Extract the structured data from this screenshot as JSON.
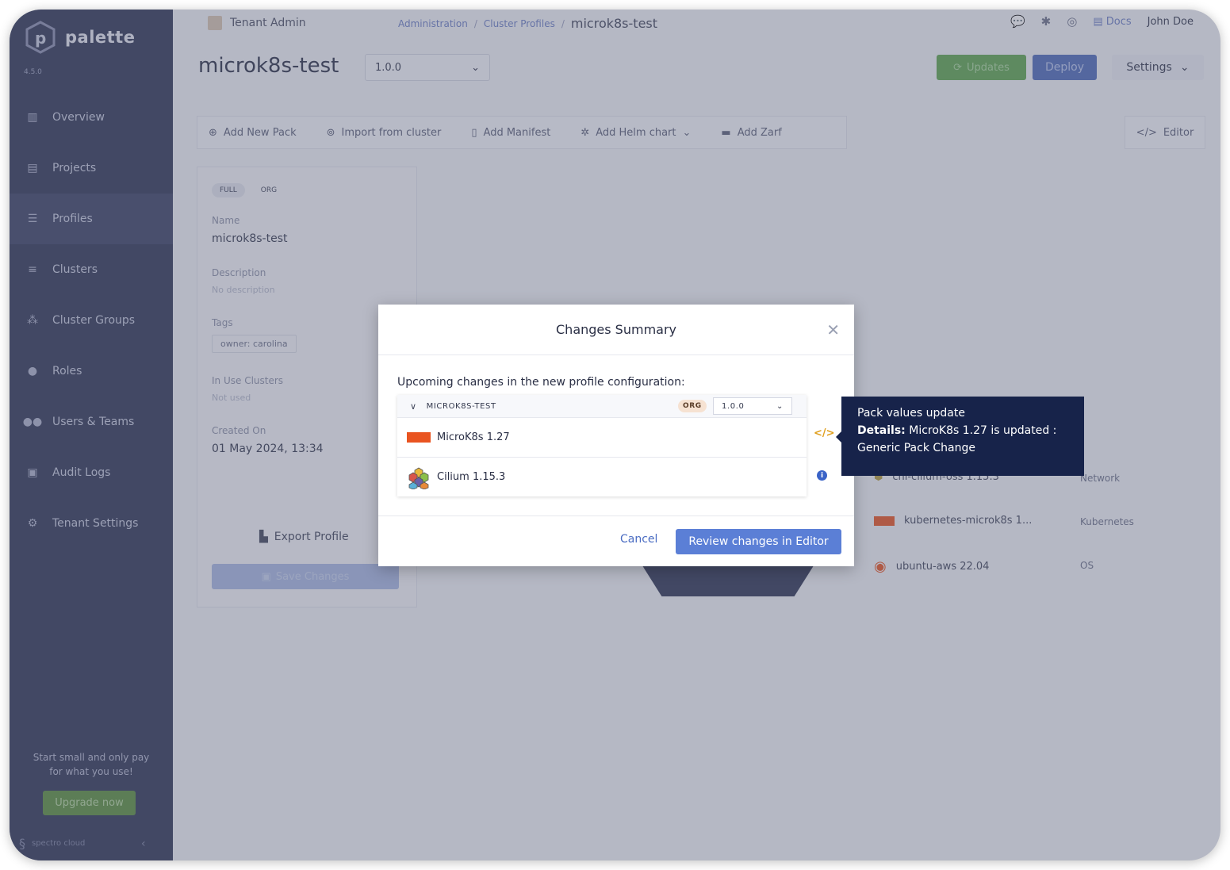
{
  "app": {
    "brand": "palette",
    "version": "4.5.0"
  },
  "sidebar": {
    "items": [
      {
        "label": "Overview",
        "icon": "chart-icon"
      },
      {
        "label": "Projects",
        "icon": "projects-icon"
      },
      {
        "label": "Profiles",
        "icon": "layers-icon",
        "active": true
      },
      {
        "label": "Clusters",
        "icon": "clusters-icon"
      },
      {
        "label": "Cluster Groups",
        "icon": "cluster-groups-icon"
      },
      {
        "label": "Roles",
        "icon": "roles-icon"
      },
      {
        "label": "Users & Teams",
        "icon": "users-icon"
      },
      {
        "label": "Audit Logs",
        "icon": "audit-icon"
      },
      {
        "label": "Tenant Settings",
        "icon": "gear-icon"
      }
    ],
    "promo_line1": "Start small and only pay",
    "promo_line2": "for what you use!",
    "upgrade_label": "Upgrade now",
    "footer_brand": "spectro cloud"
  },
  "header": {
    "tenant": "Tenant Admin",
    "breadcrumb": [
      "Administration",
      "Cluster Profiles",
      "microk8s-test"
    ],
    "docs": "Docs",
    "user": "John Doe"
  },
  "profile": {
    "title": "microk8s-test",
    "version": "1.0.0",
    "updates_label": "Updates",
    "deploy_label": "Deploy",
    "settings_label": "Settings"
  },
  "toolbar": {
    "add_new_pack": "Add New Pack",
    "import_from_cluster": "Import from cluster",
    "add_manifest": "Add Manifest",
    "add_helm_chart": "Add Helm chart",
    "add_zarf": "Add Zarf",
    "editor": "Editor"
  },
  "details": {
    "chip_full": "FULL",
    "chip_org": "ORG",
    "name_label": "Name",
    "name_value": "microk8s-test",
    "description_label": "Description",
    "description_value": "No description",
    "tags_label": "Tags",
    "tag_value": "owner: carolina",
    "in_use_label": "In Use Clusters",
    "in_use_value": "Not used",
    "created_label": "Created On",
    "created_value": "01 May 2024, 13:34",
    "export_label": "Export Profile",
    "save_label": "Save Changes"
  },
  "layers": [
    {
      "name": "cni-cilium-oss 1.15.3",
      "type": "Network"
    },
    {
      "name": "kubernetes-microk8s 1...",
      "type": "Kubernetes"
    },
    {
      "name": "ubuntu-aws 22.04",
      "type": "OS"
    }
  ],
  "modal": {
    "title": "Changes Summary",
    "subtitle": "Upcoming changes in the new profile configuration:",
    "profile_name": "MICROK8S-TEST",
    "org_badge": "ORG",
    "version": "1.0.0",
    "packs": [
      {
        "name": "MicroK8s 1.27"
      },
      {
        "name": "Cilium 1.15.3"
      }
    ],
    "cancel_label": "Cancel",
    "review_label": "Review changes in Editor"
  },
  "tooltip": {
    "title": "Pack values update",
    "details_label": "Details:",
    "details_text": "MicroK8s 1.27 is updated :",
    "details_line2": "Generic Pack Change"
  }
}
